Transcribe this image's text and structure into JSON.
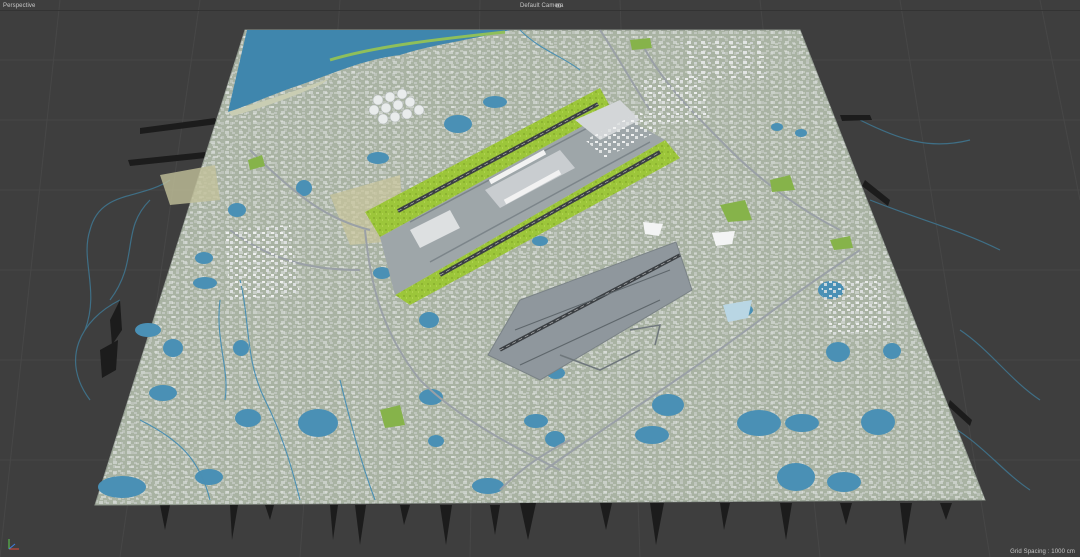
{
  "viewport": {
    "name": "Perspective",
    "camera": "Default Camera",
    "camera_icon": "camera-icon",
    "grid_spacing": "Grid Spacing : 1000 cm"
  },
  "colors": {
    "background": "#3e3e3e",
    "grid_line": "#4a4a4a",
    "terrain": "#a9b3a3",
    "water": "#4a8fb3",
    "sea": "#3f86ad",
    "grass": "#9bc23c",
    "tarmac": "#8f979d",
    "runway": "#3d4145",
    "buildings": "#d8dadb"
  }
}
